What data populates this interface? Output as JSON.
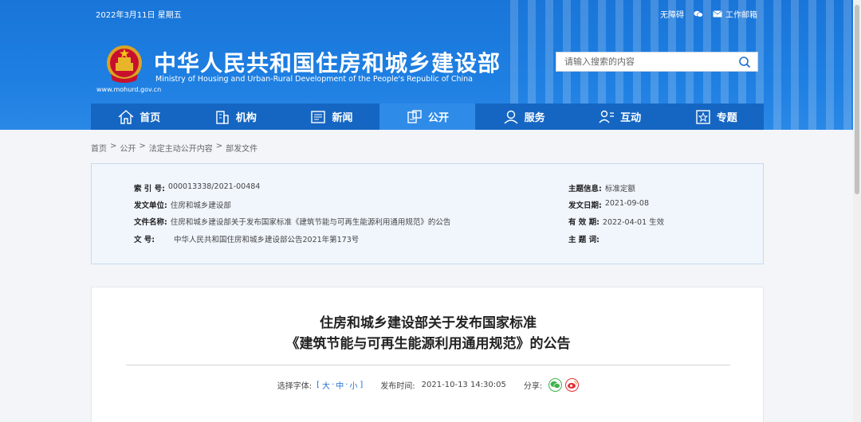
{
  "header": {
    "date": "2022年3月11日 星期五",
    "links": [
      "无障碍",
      "",
      "工作邮箱"
    ],
    "title_cn": "中华人民共和国住房和城乡建设部",
    "title_en": "Ministry of Housing and Urban-Rural Development of the People's Republic of China",
    "site_url": "www.mohurd.gov.cn",
    "search_placeholder": "请输入搜索的内容"
  },
  "nav": [
    {
      "label": "首页",
      "icon": "home-icon"
    },
    {
      "label": "机构",
      "icon": "building-icon"
    },
    {
      "label": "新闻",
      "icon": "news-icon"
    },
    {
      "label": "公开",
      "icon": "open-gov-icon",
      "active": true
    },
    {
      "label": "服务",
      "icon": "service-icon"
    },
    {
      "label": "互动",
      "icon": "interact-icon"
    },
    {
      "label": "专题",
      "icon": "topic-icon"
    }
  ],
  "breadcrumb": [
    "首页",
    "公开",
    "法定主动公开内容",
    "部发文件"
  ],
  "info": {
    "index_label": "索 引 号:",
    "index_value": "000013338/2021-00484",
    "issuer_label": "发文单位:",
    "issuer_value": "住房和城乡建设部",
    "docname_label": "文件名称:",
    "docname_value": "住房和城乡建设部关于发布国家标准《建筑节能与可再生能源利用通用规范》的公告",
    "docno_label": "文 号:",
    "docno_value": "中华人民共和国住房和城乡建设部公告2021年第173号",
    "subject_label": "主题信息:",
    "subject_value": "标准定额",
    "date_label": "发文日期:",
    "date_value": "2021-09-08",
    "valid_label": "有 效 期:",
    "valid_value": "2022-04-01 生效",
    "keywords_label": "主 题 词:",
    "keywords_value": ""
  },
  "article": {
    "title_line1": "住房和城乡建设部关于发布国家标准",
    "title_line2": "《建筑节能与可再生能源利用通用规范》的公告",
    "font_label": "选择字体:",
    "font_open": "[",
    "font_large": "大",
    "font_medium": "中",
    "font_small": "小",
    "font_close": "]",
    "font_sep": "·",
    "publish_label": "发布时间:",
    "publish_time": "2021-10-13 14:30:05",
    "share_label": "分享:"
  }
}
